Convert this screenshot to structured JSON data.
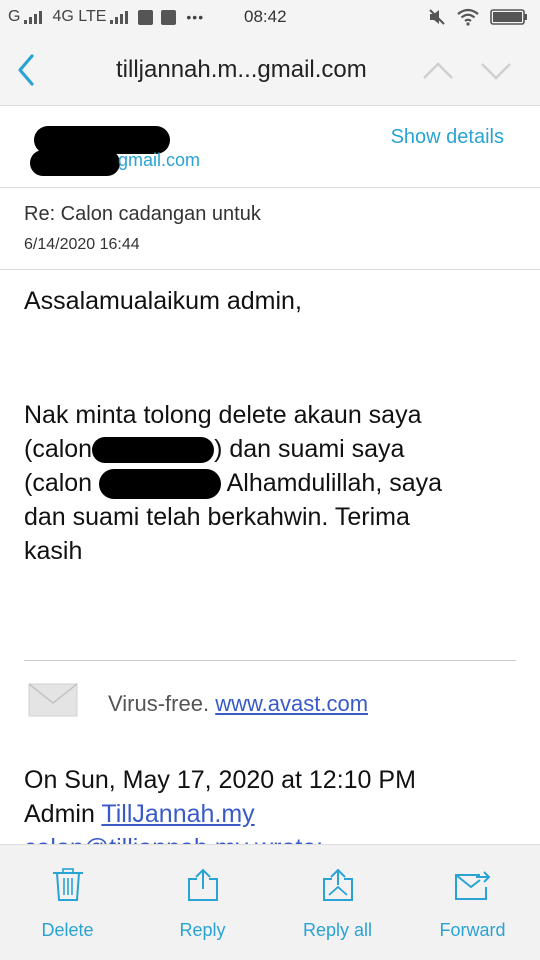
{
  "status_bar": {
    "network": "G",
    "lte_label": "4G LTE",
    "time": "08:42",
    "dots": "•••",
    "icons": [
      "signal-icon",
      "facebook-icon",
      "instagram-icon",
      "mute-icon",
      "wifi-icon",
      "battery-icon"
    ]
  },
  "header": {
    "title": "tilljannah.m...gmail.com",
    "show_details": "Show details",
    "sender_email_suffix": "gmail.com"
  },
  "message": {
    "subject": "Re: Calon cadangan untuk",
    "date": "6/14/2020 16:44",
    "greeting": "Assalamualaikum admin,",
    "body_line1": "Nak minta tolong delete akaun saya",
    "body_line2a": "(calon",
    "body_line2b": ") dan suami saya",
    "body_line3a": "(calon",
    "body_line3b": "Alhamdulillah, saya",
    "body_line4": "dan suami telah berkahwin. Terima",
    "body_line5": "kasih",
    "virus_free": "Virus-free.",
    "avast_link": "www.avast.com",
    "quote_line1": "On Sun, May 17, 2020 at 12:10 PM",
    "quote_admin": "Admin",
    "quote_link": "TillJannah.my",
    "quote_line3": "calon@tilljannah.my wrote:"
  },
  "actions": [
    {
      "label": "Delete",
      "icon": "trash-icon"
    },
    {
      "label": "Reply",
      "icon": "reply-icon"
    },
    {
      "label": "Reply all",
      "icon": "reply-all-icon"
    },
    {
      "label": "Forward",
      "icon": "forward-icon"
    }
  ],
  "colors": {
    "accent": "#29a3d4",
    "link": "#3a5bc7",
    "bar_bg": "#f4f4f4"
  }
}
